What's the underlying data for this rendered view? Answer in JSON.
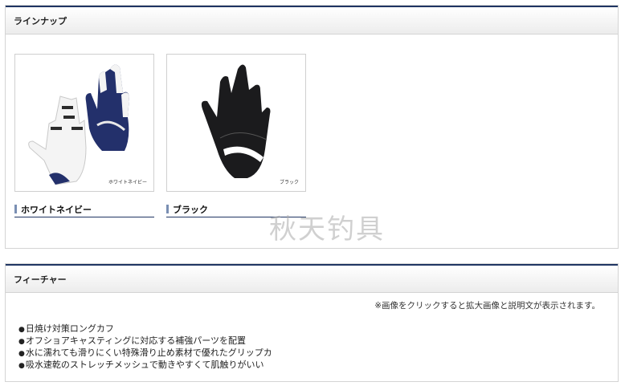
{
  "lineup": {
    "title": "ラインナップ",
    "products": [
      {
        "name": "ホワイトネイビー",
        "image_caption": "ホワイトネイビー",
        "glove_color": "#ffffff",
        "accent": "#23306b"
      },
      {
        "name": "ブラック",
        "image_caption": "ブラック",
        "glove_color": "#1b1b1d",
        "accent": "#ffffff"
      }
    ],
    "watermark": "秋天钓具"
  },
  "features": {
    "title": "フィーチャー",
    "note": "※画像をクリックすると拡大画像と説明文が表示されます。",
    "items": [
      "日焼け対策ロングカフ",
      "オフショアキャスティングに対応する補強パーツを配置",
      "水に濡れても滑りにくい特殊滑り止め素材で優れたグリップカ",
      "吸水速乾のストレッチメッシュで動きやすくて肌触りがいい"
    ]
  },
  "colors": {
    "header_border": "#1f3563",
    "name_bar": "#7a8fb3"
  }
}
